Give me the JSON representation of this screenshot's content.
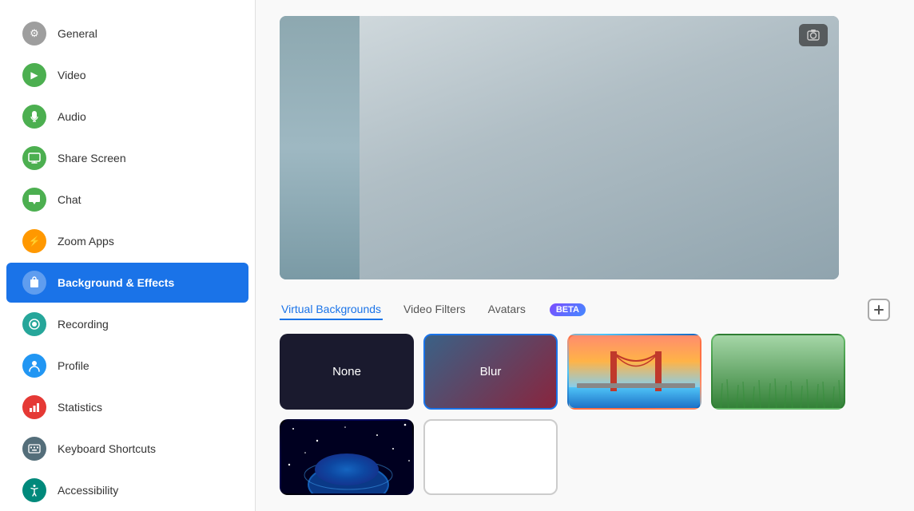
{
  "sidebar": {
    "items": [
      {
        "id": "general",
        "label": "General",
        "icon": "⚙",
        "iconBg": "icon-gray",
        "active": false
      },
      {
        "id": "video",
        "label": "Video",
        "icon": "▶",
        "iconBg": "icon-green",
        "active": false
      },
      {
        "id": "audio",
        "label": "Audio",
        "icon": "🎧",
        "iconBg": "icon-green",
        "active": false
      },
      {
        "id": "share-screen",
        "label": "Share Screen",
        "icon": "□",
        "iconBg": "icon-green",
        "active": false
      },
      {
        "id": "chat",
        "label": "Chat",
        "icon": "💬",
        "iconBg": "icon-green",
        "active": false
      },
      {
        "id": "zoom-apps",
        "label": "Zoom Apps",
        "icon": "⚡",
        "iconBg": "icon-orange",
        "active": false
      },
      {
        "id": "background-effects",
        "label": "Background & Effects",
        "icon": "👤",
        "iconBg": "icon-blue",
        "active": true
      },
      {
        "id": "recording",
        "label": "Recording",
        "icon": "⊙",
        "iconBg": "icon-teal",
        "active": false
      },
      {
        "id": "profile",
        "label": "Profile",
        "icon": "👤",
        "iconBg": "icon-blue",
        "active": false
      },
      {
        "id": "statistics",
        "label": "Statistics",
        "icon": "📊",
        "iconBg": "icon-bar-chart",
        "active": false
      },
      {
        "id": "keyboard-shortcuts",
        "label": "Keyboard Shortcuts",
        "icon": "⌨",
        "iconBg": "icon-keyboard",
        "active": false
      },
      {
        "id": "accessibility",
        "label": "Accessibility",
        "icon": "♿",
        "iconBg": "icon-accessibility",
        "active": false
      }
    ]
  },
  "main": {
    "tabs": [
      {
        "id": "virtual-backgrounds",
        "label": "Virtual Backgrounds",
        "active": true
      },
      {
        "id": "video-filters",
        "label": "Video Filters",
        "active": false
      },
      {
        "id": "avatars",
        "label": "Avatars",
        "active": false
      }
    ],
    "beta_label": "BETA",
    "add_button_label": "+",
    "tiles": [
      {
        "id": "none",
        "label": "None",
        "type": "none",
        "selected": false
      },
      {
        "id": "blur",
        "label": "Blur",
        "type": "blur",
        "selected": true
      },
      {
        "id": "bridge",
        "label": "",
        "type": "bridge",
        "selected": false
      },
      {
        "id": "grass",
        "label": "",
        "type": "grass",
        "selected": false
      },
      {
        "id": "space",
        "label": "",
        "type": "space",
        "selected": false
      },
      {
        "id": "blank",
        "label": "",
        "type": "blank",
        "selected": false
      }
    ]
  }
}
